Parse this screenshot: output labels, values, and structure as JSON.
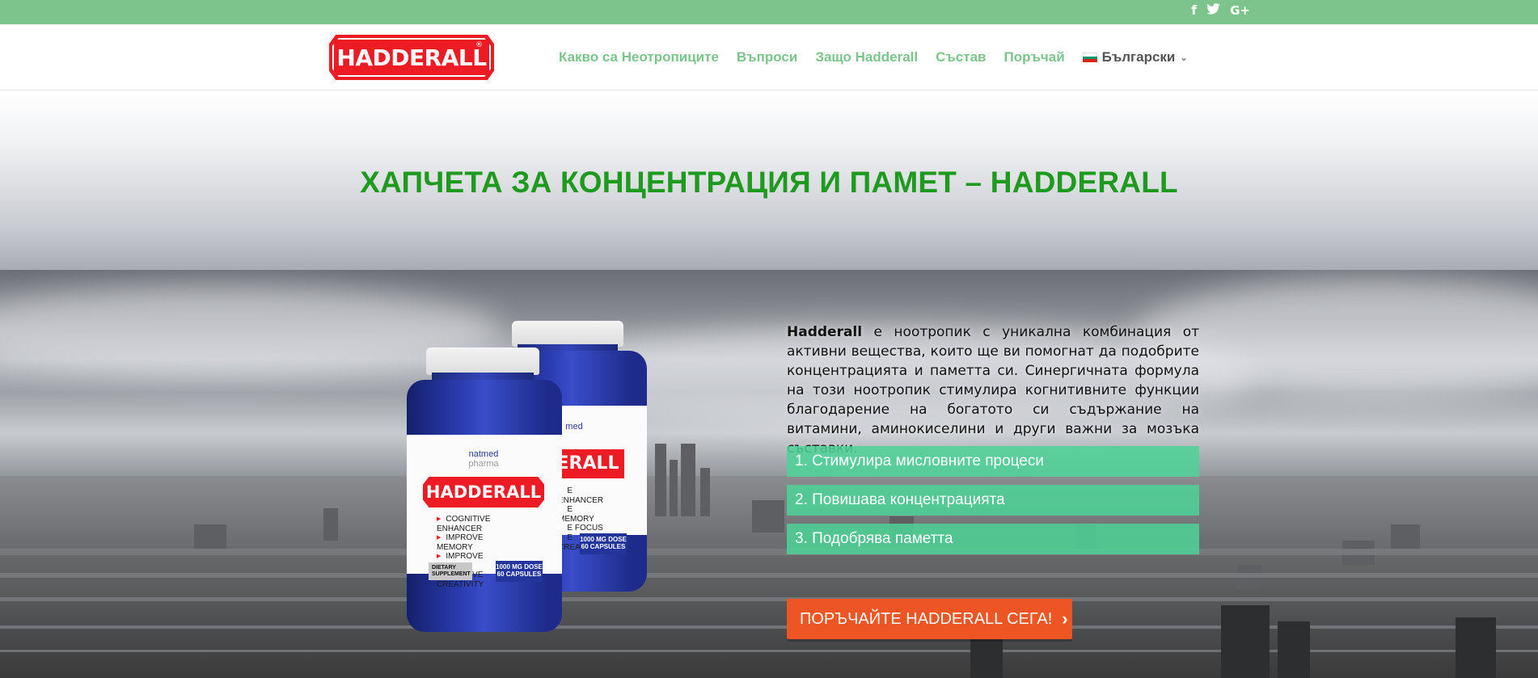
{
  "social": {
    "facebook_icon": "f",
    "twitter_icon": "t",
    "gplus_icon": "G+"
  },
  "header": {
    "logo_text": "HADDERALL",
    "logo_reg": "®",
    "nav": [
      {
        "label": "Какво са Неотропиците"
      },
      {
        "label": "Въпроси"
      },
      {
        "label": "Защо Hadderall"
      },
      {
        "label": "Състав"
      },
      {
        "label": "Поръчай"
      }
    ],
    "language": "Български"
  },
  "title": "ХАПЧЕТА ЗА КОНЦЕНТРАЦИЯ И ПАМЕТ – HADDERALL",
  "product": {
    "maker_line1": "natmed",
    "maker_line2": "pharma",
    "label_logo": "HADDERALL",
    "bullets": [
      "COGNITIVE ENHANCER",
      "IMPROVE MEMORY",
      "IMPROVE FOCUS",
      "IMPROVE CREATIVITY"
    ],
    "back_bullets": [
      "E ENHANCER",
      "E MEMORY",
      "E FOCUS",
      "E CREATIVITY"
    ],
    "diet_line1": "DIETARY",
    "diet_line2": "SUPPLEMENT",
    "dose_line1": "1000 MG DOSE",
    "dose_line2": "60 CAPSULES",
    "back_logo": "ERALL",
    "back_maker": "med"
  },
  "description": {
    "brand": "Hadderall",
    "text": " е ноотропик с уникална комбинация от активни вещества, които ще ви помогнат да подобрите концентрацията и паметта си. Синергичната формула на този ноотропик стимулира когнитивните функции благодарение на богатото си съдържание на витамини, аминокиселини и други важни за мозъка съставки."
  },
  "benefits": [
    "1. Стимулира мисловните процеси",
    "2. Повишава концентрацията",
    "3. Подобрява паметта"
  ],
  "cta": {
    "label": "ПОРЪЧАЙТЕ HADDERALL СЕГА!",
    "arrow": "›"
  },
  "colors": {
    "topbar": "#7cc48c",
    "nav": "#7cc48c",
    "title": "#1e9a1e",
    "benefit": "#4cd496",
    "cta": "#ee5525",
    "logo": "#ed1c24"
  }
}
